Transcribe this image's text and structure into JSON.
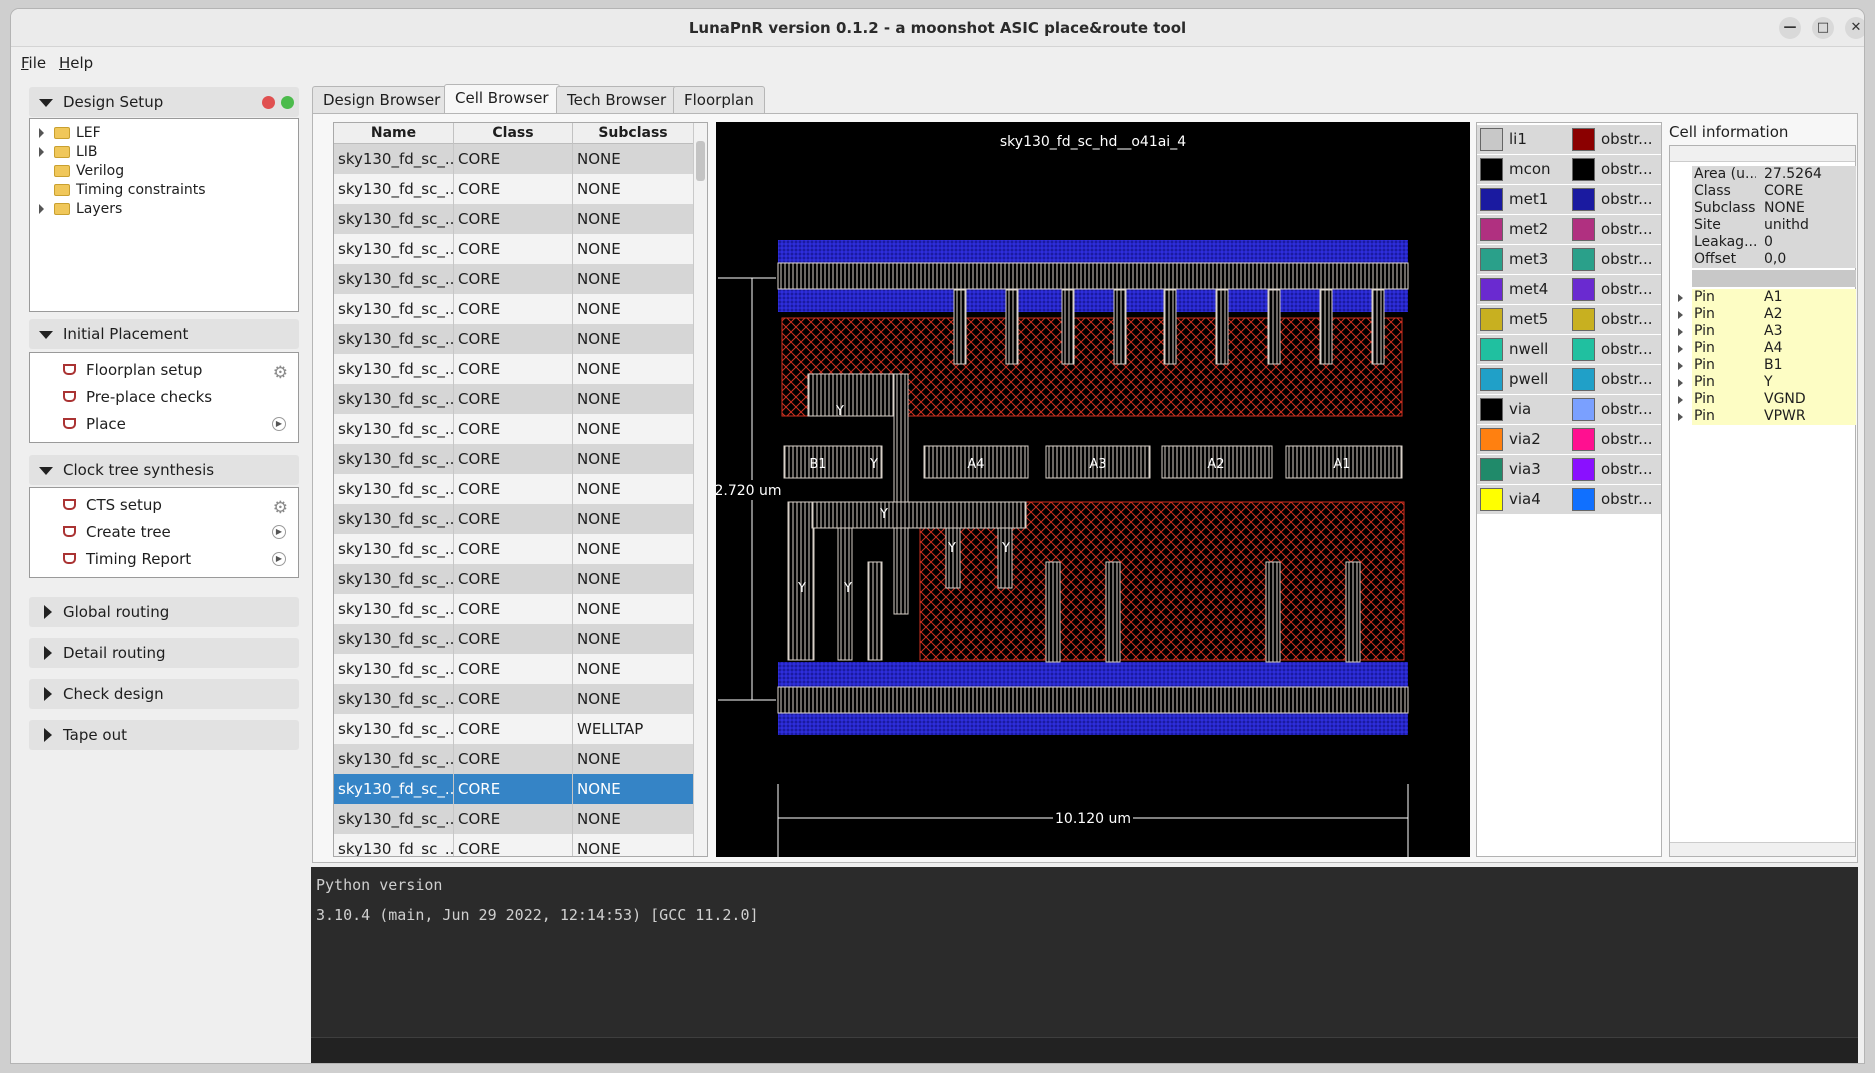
{
  "window": {
    "title": "LunaPnR version 0.1.2 - a moonshot ASIC place&route tool"
  },
  "menu": {
    "file": "File",
    "help": "Help"
  },
  "sidebar": {
    "design_setup": {
      "title": "Design Setup",
      "items": [
        {
          "label": "LEF",
          "expandable": true
        },
        {
          "label": "LIB",
          "expandable": true
        },
        {
          "label": "Verilog",
          "expandable": false
        },
        {
          "label": "Timing constraints",
          "expandable": false
        },
        {
          "label": "Layers",
          "expandable": true
        }
      ]
    },
    "initial_placement": {
      "title": "Initial Placement",
      "steps": [
        "Floorplan setup",
        "Pre-place checks",
        "Place"
      ]
    },
    "cts": {
      "title": "Clock tree synthesis",
      "steps": [
        "CTS setup",
        "Create tree",
        "Timing Report"
      ]
    },
    "collapsed": [
      "Global routing",
      "Detail routing",
      "Check design",
      "Tape out"
    ]
  },
  "tabs": [
    "Design Browser",
    "Cell Browser",
    "Tech Browser",
    "Floorplan"
  ],
  "active_tab": "Cell Browser",
  "cell_table": {
    "headers": [
      "Name",
      "Class",
      "Subclass"
    ],
    "rows": [
      [
        "sky130_fd_sc_...",
        "CORE",
        "NONE"
      ],
      [
        "sky130_fd_sc_...",
        "CORE",
        "NONE"
      ],
      [
        "sky130_fd_sc_...",
        "CORE",
        "NONE"
      ],
      [
        "sky130_fd_sc_...",
        "CORE",
        "NONE"
      ],
      [
        "sky130_fd_sc_...",
        "CORE",
        "NONE"
      ],
      [
        "sky130_fd_sc_...",
        "CORE",
        "NONE"
      ],
      [
        "sky130_fd_sc_...",
        "CORE",
        "NONE"
      ],
      [
        "sky130_fd_sc_...",
        "CORE",
        "NONE"
      ],
      [
        "sky130_fd_sc_...",
        "CORE",
        "NONE"
      ],
      [
        "sky130_fd_sc_...",
        "CORE",
        "NONE"
      ],
      [
        "sky130_fd_sc_...",
        "CORE",
        "NONE"
      ],
      [
        "sky130_fd_sc_...",
        "CORE",
        "NONE"
      ],
      [
        "sky130_fd_sc_...",
        "CORE",
        "NONE"
      ],
      [
        "sky130_fd_sc_...",
        "CORE",
        "NONE"
      ],
      [
        "sky130_fd_sc_...",
        "CORE",
        "NONE"
      ],
      [
        "sky130_fd_sc_...",
        "CORE",
        "NONE"
      ],
      [
        "sky130_fd_sc_...",
        "CORE",
        "NONE"
      ],
      [
        "sky130_fd_sc_...",
        "CORE",
        "NONE"
      ],
      [
        "sky130_fd_sc_...",
        "CORE",
        "NONE"
      ],
      [
        "sky130_fd_sc_...",
        "CORE",
        "WELLTAP"
      ],
      [
        "sky130_fd_sc_...",
        "CORE",
        "NONE"
      ],
      [
        "sky130_fd_sc_...",
        "CORE",
        "NONE"
      ],
      [
        "sky130_fd_sc_...",
        "CORE",
        "NONE"
      ],
      [
        "sky130_fd_sc_...",
        "CORE",
        "NONE"
      ]
    ],
    "selected_index": 21
  },
  "layout_view": {
    "cell_name": "sky130_fd_sc_hd__o41ai_4",
    "height_label": "2.720 um",
    "width_label": "10.120 um",
    "pins": [
      "B1",
      "Y",
      "A4",
      "A3",
      "A2",
      "A1"
    ],
    "y_labels": [
      "Y",
      "Y",
      "Y",
      "Y",
      "Y",
      "Y"
    ]
  },
  "layer_list": [
    {
      "name": "li1",
      "obs": "obstr...",
      "color": "#c8c8c8",
      "obs_color": "#8b0000"
    },
    {
      "name": "mcon",
      "obs": "obstr...",
      "color": "#000000",
      "obs_color": "#000000"
    },
    {
      "name": "met1",
      "obs": "obstr...",
      "color": "#1a1aa0",
      "obs_color": "#1a1aa0"
    },
    {
      "name": "met2",
      "obs": "obstr...",
      "color": "#b03080",
      "obs_color": "#b03080"
    },
    {
      "name": "met3",
      "obs": "obstr...",
      "color": "#2aa08a",
      "obs_color": "#2aa08a"
    },
    {
      "name": "met4",
      "obs": "obstr...",
      "color": "#6a2ad0",
      "obs_color": "#6a2ad0"
    },
    {
      "name": "met5",
      "obs": "obstr...",
      "color": "#c8b020",
      "obs_color": "#c8b020"
    },
    {
      "name": "nwell",
      "obs": "obstr...",
      "color": "#20c0a0",
      "obs_color": "#20c0a0"
    },
    {
      "name": "pwell",
      "obs": "obstr...",
      "color": "#20a0c8",
      "obs_color": "#20a0c8"
    },
    {
      "name": "via",
      "obs": "obstr...",
      "color": "#000000",
      "obs_color": "#7aa0ff"
    },
    {
      "name": "via2",
      "obs": "obstr...",
      "color": "#ff8010",
      "obs_color": "#ff1090"
    },
    {
      "name": "via3",
      "obs": "obstr...",
      "color": "#208a6a",
      "obs_color": "#8a10ff"
    },
    {
      "name": "via4",
      "obs": "obstr...",
      "color": "#ffff00",
      "obs_color": "#1070ff"
    }
  ],
  "cell_info": {
    "title": "Cell information",
    "properties": [
      [
        "Area (u...",
        "27.5264"
      ],
      [
        "Class",
        "CORE"
      ],
      [
        "Subclass",
        "NONE"
      ],
      [
        "Site",
        "unithd"
      ],
      [
        "Leakag...",
        "0"
      ],
      [
        "Offset",
        "0,0"
      ]
    ],
    "pins": [
      [
        "Pin",
        "A1"
      ],
      [
        "Pin",
        "A2"
      ],
      [
        "Pin",
        "A3"
      ],
      [
        "Pin",
        "A4"
      ],
      [
        "Pin",
        "B1"
      ],
      [
        "Pin",
        "Y"
      ],
      [
        "Pin",
        "VGND"
      ],
      [
        "Pin",
        "VPWR"
      ]
    ]
  },
  "console": {
    "line1": "Python version",
    "line2": "3.10.4 (main, Jun 29 2022, 12:14:53) [GCC 11.2.0]"
  }
}
